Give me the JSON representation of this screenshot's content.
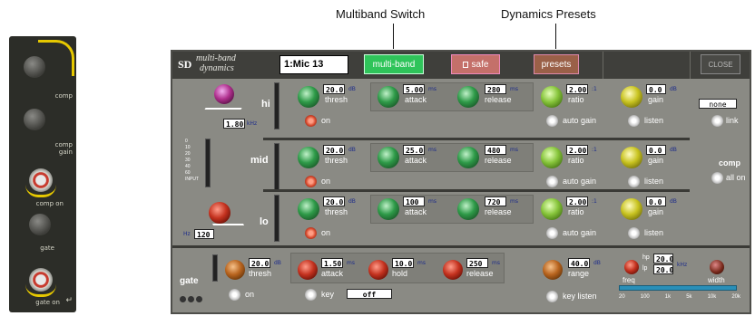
{
  "callouts": {
    "multiband": "Multiband Switch",
    "presets": "Dynamics Presets"
  },
  "strip": {
    "comp": "comp",
    "comp_gain": "comp gain",
    "comp_on": "comp on",
    "gate": "gate",
    "gate_on": "gate on"
  },
  "header": {
    "logo": "SD",
    "title_line1": "multi-band",
    "title_line2": "dynamics",
    "channel": "1:Mic 13",
    "multiband_btn": "multi-band",
    "safe_btn": "safe",
    "presets_btn": "presets",
    "close_btn": "CLOSE"
  },
  "meter_scale": [
    "0",
    "5",
    "10",
    "20",
    "30",
    "dB"
  ],
  "input_scale": [
    "0",
    "10",
    "20",
    "30",
    "40",
    "60",
    "INPUT"
  ],
  "bands": [
    {
      "name": "hi",
      "thresh": "20.0",
      "attack": "5.00",
      "release": "280",
      "ratio": "2.00",
      "gain": "0.0",
      "xover": "1.80",
      "xover_unit": "kHz"
    },
    {
      "name": "mid",
      "thresh": "20.0",
      "attack": "25.0",
      "release": "480",
      "ratio": "2.00",
      "gain": "0.0"
    },
    {
      "name": "lo",
      "thresh": "20.0",
      "attack": "100",
      "release": "720",
      "ratio": "2.00",
      "gain": "0.0",
      "xover": "120",
      "xover_unit": "Hz"
    }
  ],
  "labels": {
    "thresh": "thresh",
    "attack": "attack",
    "release": "release",
    "ratio": "ratio",
    "gain": "gain",
    "on": "on",
    "auto_gain": "auto gain",
    "listen": "listen",
    "link": "link",
    "none": "none",
    "comp": "comp",
    "all_on": "all on"
  },
  "units": {
    "db": "dB",
    "ms": "ms",
    "ratio": ":1"
  },
  "gate": {
    "title": "gate",
    "thresh": "20.0",
    "attack": "1.50",
    "hold": "10.0",
    "release": "250",
    "range": "40.0",
    "key": "key",
    "key_value": "off",
    "key_listen": "key listen",
    "hp": "20.0",
    "lp": "20.0",
    "hp_label": "hp",
    "lp_label": "lp",
    "thresh_label": "thresh",
    "attack_label": "attack",
    "hold_label": "hold",
    "release_label": "release",
    "range_label": "range",
    "on": "on",
    "freq": "freq",
    "width": "width",
    "khz": "kHz",
    "scale": [
      "20",
      "100",
      "1k",
      "5k",
      "10k",
      "20k"
    ]
  }
}
